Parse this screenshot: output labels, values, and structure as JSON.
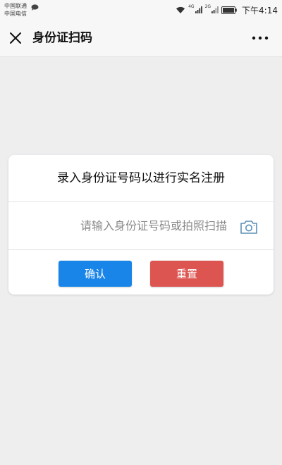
{
  "status_bar": {
    "carrier_1": "中国联通",
    "carrier_2": "中国电信",
    "network_1": "4G",
    "network_2": "2G",
    "time": "下午4:14",
    "icons": [
      "chat-bubble-icon",
      "wifi-icon",
      "signal-icon",
      "signal-icon",
      "battery-icon"
    ]
  },
  "nav": {
    "title": "身份证扫码",
    "close_icon": "close-icon",
    "more_icon": "more-icon"
  },
  "card": {
    "title": "录入身份证号码以进行实名注册",
    "input": {
      "value": "",
      "placeholder": "请输入身份证号码或拍照扫描"
    },
    "camera_icon": "camera-icon",
    "confirm_label": "确认",
    "reset_label": "重置"
  },
  "colors": {
    "confirm_button": "#1a85e8",
    "reset_button": "#dc5550",
    "background": "#eeeeef"
  }
}
